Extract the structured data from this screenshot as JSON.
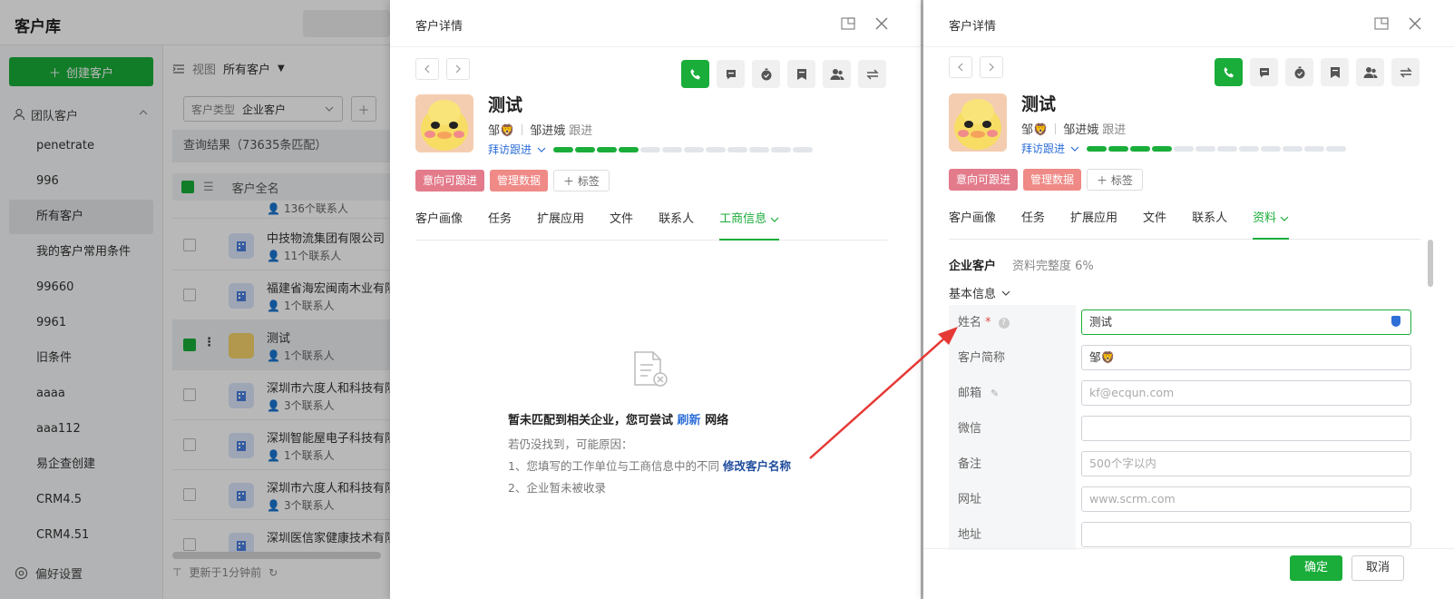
{
  "app": {
    "title": "客户库",
    "create_button": "创建客户",
    "group_label": "团队客户",
    "sidebar_items": [
      "penetrate",
      "996",
      "所有客户",
      "我的客户常用条件",
      "99660",
      "9961",
      "旧条件",
      "aaaa",
      "aaa112",
      "易企查创建",
      "CRM4.5",
      "CRM4.51"
    ],
    "preferences": "偏好设置"
  },
  "list": {
    "view_label": "视图",
    "view_value": "所有客户",
    "filter_label": "客户类型",
    "filter_value": "企业客户",
    "result_text": "查询结果（73635条匹配）",
    "column_name": "客户全名",
    "rows": [
      {
        "name": "",
        "sub": "136个联系人"
      },
      {
        "name": "中技物流集团有限公司",
        "sub": "11个联系人"
      },
      {
        "name": "福建省海宏闽南木业有限",
        "sub": "1个联系人"
      },
      {
        "name": "测试",
        "sub": "1个联系人"
      },
      {
        "name": "深圳市六度人和科技有限",
        "sub": "3个联系人"
      },
      {
        "name": "深圳智能屋电子科技有限",
        "sub": "1个联系人"
      },
      {
        "name": "深圳市六度人和科技有限",
        "sub": "3个联系人"
      },
      {
        "name": "深圳医信家健康技术有限",
        "sub": ""
      }
    ],
    "footer": "更新于1分钟前"
  },
  "drawer1": {
    "title": "客户详情",
    "customer_name": "测试",
    "short_name": "邹🦁",
    "owner": "邹进娥",
    "owner_action": "跟进",
    "stage": "拜访跟进",
    "progress_done": 4,
    "progress_total": 12,
    "tags": [
      "意向可跟进",
      "管理数据"
    ],
    "tag_add": "标签",
    "tabs": [
      "客户画像",
      "任务",
      "扩展应用",
      "文件",
      "联系人",
      "工商信息"
    ],
    "empty": {
      "title_pre": "暂未匹配到相关企业，您可尝试",
      "title_link": "刷新",
      "title_post": "网络",
      "line1": "若仍没找到，可能原因：",
      "line2_pre": "1、您填写的工作单位与工商信息中的不同",
      "line2_link": "修改客户名称",
      "line3": "2、企业暂未被收录"
    }
  },
  "drawer2": {
    "title": "客户详情",
    "customer_name": "测试",
    "short_name": "邹🦁",
    "owner": "邹进娥",
    "owner_action": "跟进",
    "stage": "拜访跟进",
    "tags": [
      "意向可跟进",
      "管理数据"
    ],
    "tag_add": "标签",
    "tabs": [
      "客户画像",
      "任务",
      "扩展应用",
      "文件",
      "联系人",
      "资料"
    ],
    "section_title": "企业客户",
    "completeness": "资料完整度 6%",
    "basic_info": "基本信息",
    "fields": [
      {
        "label": "姓名",
        "required": "*",
        "value": "测试",
        "placeholder": ""
      },
      {
        "label": "客户简称",
        "required": "",
        "value": "邹🦁",
        "placeholder": ""
      },
      {
        "label": "邮箱",
        "required": "",
        "value": "",
        "placeholder": "kf@ecqun.com"
      },
      {
        "label": "微信",
        "required": "",
        "value": "",
        "placeholder": ""
      },
      {
        "label": "备注",
        "required": "",
        "value": "",
        "placeholder": "500个字以内"
      },
      {
        "label": "网址",
        "required": "",
        "value": "",
        "placeholder": "www.scrm.com"
      },
      {
        "label": "地址",
        "required": "",
        "value": "",
        "placeholder": ""
      }
    ],
    "ok_button": "确定",
    "cancel_button": "取消"
  },
  "colors": {
    "accent": "#1aad3a",
    "link": "#2e6fd8",
    "tag_pink": "#e37b8b",
    "tag_salmon": "#ef8a86",
    "arrow": "#e53935"
  }
}
